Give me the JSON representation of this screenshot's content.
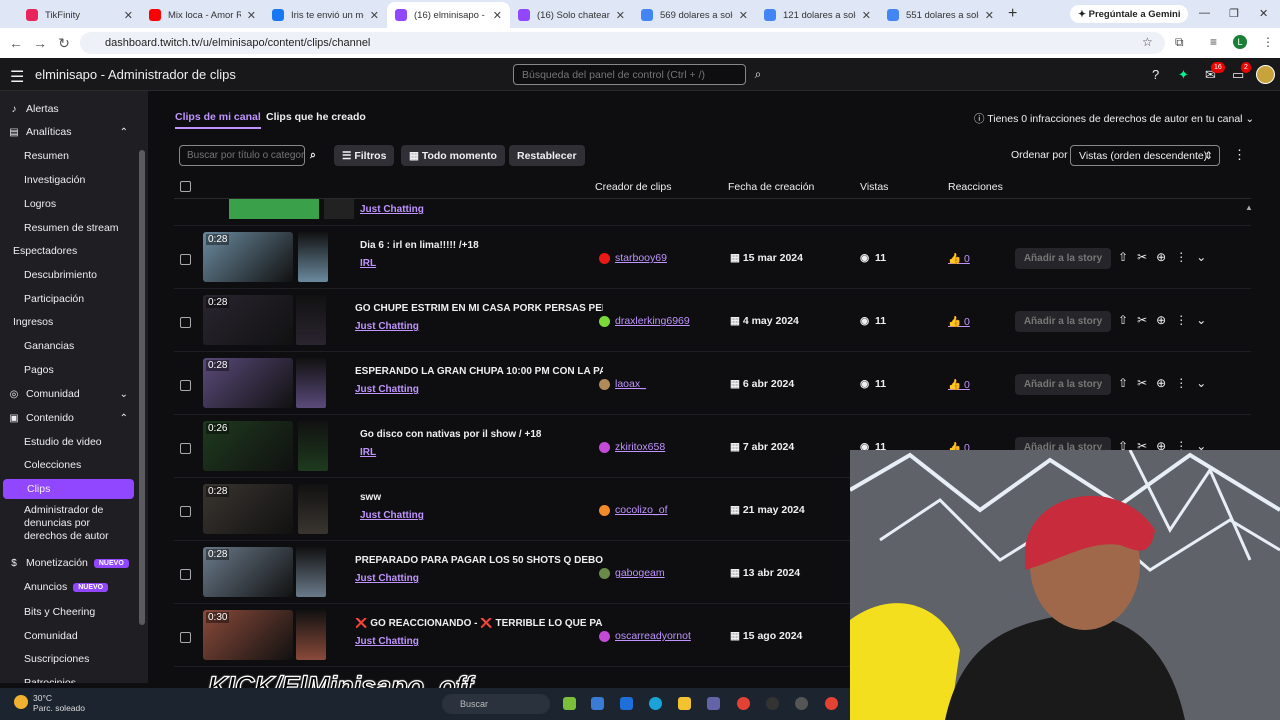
{
  "browser": {
    "tabs": [
      {
        "title": "TikFinity",
        "color": "#e9245c",
        "active": false
      },
      {
        "title": "Mix loca - Amor Rebelde",
        "color": "#ff0000",
        "active": false
      },
      {
        "title": "Iris te envió un mensaje",
        "color": "#1877f2",
        "active": false
      },
      {
        "title": "(16) elminisapo - Adm",
        "color": "#9147ff",
        "active": true
      },
      {
        "title": "(16) Solo chateando",
        "color": "#9147ff",
        "active": false
      },
      {
        "title": "569 dolares a soles",
        "color": "#4285f4",
        "active": false
      },
      {
        "title": "121 dolares a soles",
        "color": "#4285f4",
        "active": false
      },
      {
        "title": "551 dolares a soles",
        "color": "#4285f4",
        "active": false
      }
    ],
    "gemini": "Pregúntale a Gemini",
    "url": "dashboard.twitch.tv/u/elminisapo/content/clips/channel",
    "profile_initial": "L"
  },
  "topbar": {
    "title": "elminisapo - Administrador de clips",
    "search_placeholder": "Búsqueda del panel de control (Ctrl + /)",
    "badges": [
      "16",
      "2"
    ]
  },
  "sidebar": {
    "items": [
      {
        "label": "Alertas",
        "type": "head-icon",
        "icon": "bell-icon"
      },
      {
        "label": "Analíticas",
        "type": "head-icon",
        "icon": "chart-icon",
        "chevron": "up"
      },
      {
        "label": "Resumen",
        "type": "sub"
      },
      {
        "label": "Investigación",
        "type": "sub"
      },
      {
        "label": "Logros",
        "type": "sub"
      },
      {
        "label": "Resumen de stream",
        "type": "sub"
      },
      {
        "label": "Espectadores",
        "type": "head"
      },
      {
        "label": "Descubrimiento",
        "type": "sub"
      },
      {
        "label": "Participación",
        "type": "sub"
      },
      {
        "label": "Ingresos",
        "type": "head"
      },
      {
        "label": "Ganancias",
        "type": "sub"
      },
      {
        "label": "Pagos",
        "type": "sub"
      },
      {
        "label": "Comunidad",
        "type": "head-icon",
        "icon": "community-icon",
        "chevron": "down"
      },
      {
        "label": "Contenido",
        "type": "head-icon",
        "icon": "content-icon",
        "chevron": "up"
      },
      {
        "label": "Estudio de video",
        "type": "sub"
      },
      {
        "label": "Colecciones",
        "type": "sub"
      },
      {
        "label": "Clips",
        "type": "sub",
        "active": true
      },
      {
        "label": "Administrador de denuncias por derechos de autor",
        "type": "sub"
      },
      {
        "label": "Monetización",
        "type": "head-icon",
        "icon": "money-icon",
        "badge": "NUEVO"
      },
      {
        "label": "Anuncios",
        "type": "sub",
        "badge": "NUEVO"
      },
      {
        "label": "Bits y Cheering",
        "type": "sub"
      },
      {
        "label": "Comunidad",
        "type": "sub"
      },
      {
        "label": "Suscripciones",
        "type": "sub"
      },
      {
        "label": "Patrocinios",
        "type": "sub"
      }
    ]
  },
  "main": {
    "tab_mine": "Clips de mi canal",
    "tab_created": "Clips que he creado",
    "infractions": "Tienes 0 infracciones de derechos de autor en tu canal",
    "filter_placeholder": "Buscar por título o categoría",
    "filters": "Filtros",
    "time": "Todo momento",
    "reset": "Restablecer",
    "order_label": "Ordenar por",
    "order_value": "Vistas (orden descendente)",
    "columns": {
      "creator": "Creador de clips",
      "date": "Fecha de creación",
      "views": "Vistas",
      "reactions": "Reacciones"
    },
    "partial_category": "Just Chatting",
    "story_label": "Añadir a la story",
    "rows": [
      {
        "duration": "0:28",
        "title": "Dia 6 : irl en lima!!!!! /+18",
        "category": "IRL",
        "creator": "starbooy69",
        "date": "15 mar 2024",
        "views": "11",
        "reactions": "0",
        "thumb": "#6b8a9e",
        "dot": "#e91916"
      },
      {
        "duration": "0:28",
        "title": "GO CHUPE ESTRIM EN MI CASA PORK PERSAS PERDI...",
        "category": "Just Chatting",
        "creator": "draxlerking6969",
        "date": "4 may 2024",
        "views": "11",
        "reactions": "0",
        "thumb": "#2a2530",
        "dot": "#7bd93a"
      },
      {
        "duration": "0:28",
        "title": "ESPERANDO LA GRAN CHUPA 10:00 PM CON LA PAY...",
        "category": "Just Chatting",
        "creator": "laoax_",
        "date": "6 abr 2024",
        "views": "11",
        "reactions": "0",
        "thumb": "#5a4a7a",
        "dot": "#b08a5a"
      },
      {
        "duration": "0:26",
        "title": "Go disco con nativas por il show / +18",
        "category": "IRL",
        "creator": "zkiritox658",
        "date": "7 abr 2024",
        "views": "11",
        "reactions": "0",
        "thumb": "#1e3a1e",
        "dot": "#c54ad8"
      },
      {
        "duration": "0:28",
        "title": "sww",
        "category": "Just Chatting",
        "creator": "cocolizo_of",
        "date": "21 may 2024",
        "views": "",
        "reactions": "",
        "thumb": "#3a3530",
        "dot": "#f08a2a"
      },
      {
        "duration": "0:28",
        "title": "PREPARADO PARA PAGAR LOS 50 SHOTS Q DEBO !!! / ...",
        "category": "Just Chatting",
        "creator": "gabogeam",
        "date": "13 abr 2024",
        "views": "",
        "reactions": "",
        "thumb": "#6a7a8a",
        "dot": "#6a8a4a"
      },
      {
        "duration": "0:30",
        "title": "❌ GO REACCIONANDO - ❌ TERRIBLE LO QUE PASAR...",
        "category": "Just Chatting",
        "creator": "oscarreadyornot",
        "date": "15 ago 2024",
        "views": "",
        "reactions": "",
        "thumb": "#8a4a3a",
        "dot": "#c54ad8"
      }
    ]
  },
  "overlay": {
    "kick": "KICK/ElMinisapo_off"
  },
  "taskbar": {
    "temp": "30°C",
    "weather": "Parc. soleado",
    "search": "Buscar"
  }
}
